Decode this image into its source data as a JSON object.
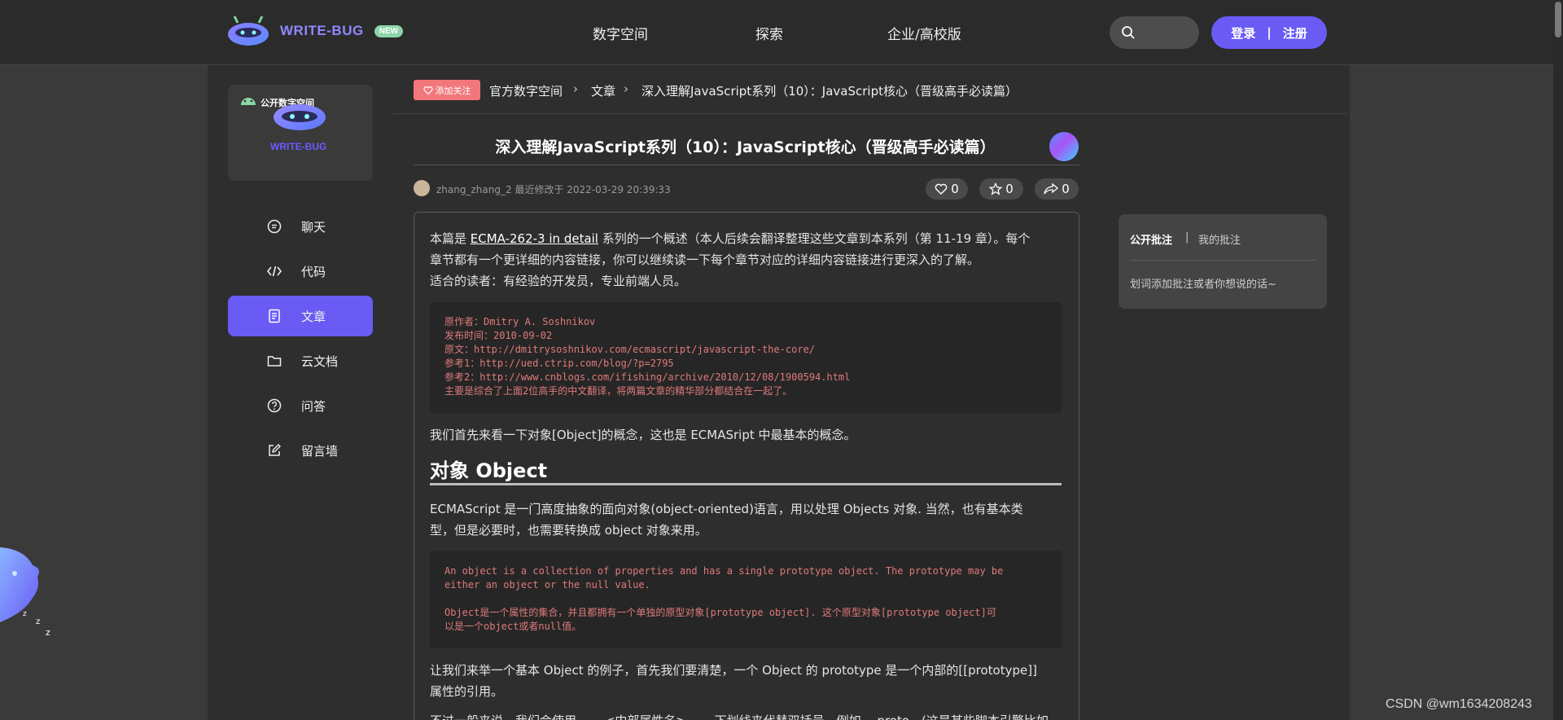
{
  "header": {
    "logo_text": "WRITE-BUG",
    "new_badge": "NEW",
    "nav": [
      "数字空间",
      "探索",
      "企业/高校版"
    ],
    "search_placeholder": "",
    "login": "登录",
    "divider": "|",
    "register": "注册"
  },
  "sidebar": {
    "space_label": "公开数字空间",
    "space_logo_text": "WRITE-BUG",
    "items": [
      {
        "label": "聊天",
        "icon": "chat-icon"
      },
      {
        "label": "代码",
        "icon": "code-icon"
      },
      {
        "label": "文章",
        "icon": "article-icon",
        "active": true
      },
      {
        "label": "云文档",
        "icon": "folder-icon"
      },
      {
        "label": "问答",
        "icon": "question-icon"
      },
      {
        "label": "留言墙",
        "icon": "edit-icon"
      }
    ]
  },
  "breadcrumb": {
    "follow": "添加关注",
    "items": [
      "官方数字空间",
      "文章",
      "深入理解JavaScript系列（10）：JavaScript核心（晋级高手必读篇）"
    ]
  },
  "article": {
    "title": "深入理解JavaScript系列（10）：JavaScript核心（晋级高手必读篇）",
    "author": "zhang_zhang_2",
    "meta_suffix": "最近修改于 2022-03-29 20:39:33",
    "likes": "0",
    "stars": "0",
    "shares": "0",
    "intro_prefix": "本篇是 ",
    "intro_link": "ECMA-262-3 in detail",
    "intro_rest_line1": " 系列的一个概述（本人后续会翻译整理这些文章到本系列（第 11-19 章）。每个",
    "intro_line2": "章节都有一个更详细的内容链接，你可以继续读一下每个章节对应的详细内容链接进行更深入的了解。",
    "intro_line3": "适合的读者：有经验的开发员，专业前端人员。",
    "code1": [
      "原作者：Dmitry A. Soshnikov",
      "发布时间：2010-09-02",
      "原文：http://dmitrysoshnikov.com/ecmascript/javascript-the-core/",
      "参考1：http://ued.ctrip.com/blog/?p=2795",
      "参考2：http://www.cnblogs.com/ifishing/archive/2010/12/08/1900594.html",
      "主要是综合了上面2位高手的中文翻译，将两篇文章的精华部分都结合在一起了。"
    ],
    "para2": "我们首先来看一下对象[Object]的概念，这也是 ECMASript 中最基本的概念。",
    "heading": "对象 Object",
    "para3_line1": "ECMAScript 是一门高度抽象的面向对象(object-oriented)语言，用以处理 Objects 对象. 当然，也有基本类",
    "para3_line2": "型，但是必要时，也需要转换成 object 对象来用。",
    "code2": [
      "An object is a collection of properties and has a single prototype object. The prototype may be",
      "either an object or the null value.",
      "",
      "Object是一个属性的集合，并且都拥有一个单独的原型对象[prototype object]. 这个原型对象[prototype object]可",
      "以是一个object或者null值。"
    ],
    "para4_line1": "让我们来举一个基本 Object 的例子，首先我们要清楚，一个 Object 的 prototype 是一个内部的[[prototype]]",
    "para4_line2": "属性的引用。",
    "para5_partial": "不过一般来说，我们会使用 ＿＿<内部属性名>＿＿ 下划线来代替双括号，例如 __proto__(这是某些脚本引擎比如"
  },
  "annotations": {
    "tab_public": "公开批注",
    "sep": "|",
    "tab_mine": "我的批注",
    "hint": "划词添加批注或者你想说的话~"
  },
  "watermark": "CSDN @wm1634208243",
  "colors": {
    "accent": "#6a5bf5",
    "follow": "#f2777c",
    "code_text": "#e07a7a"
  }
}
